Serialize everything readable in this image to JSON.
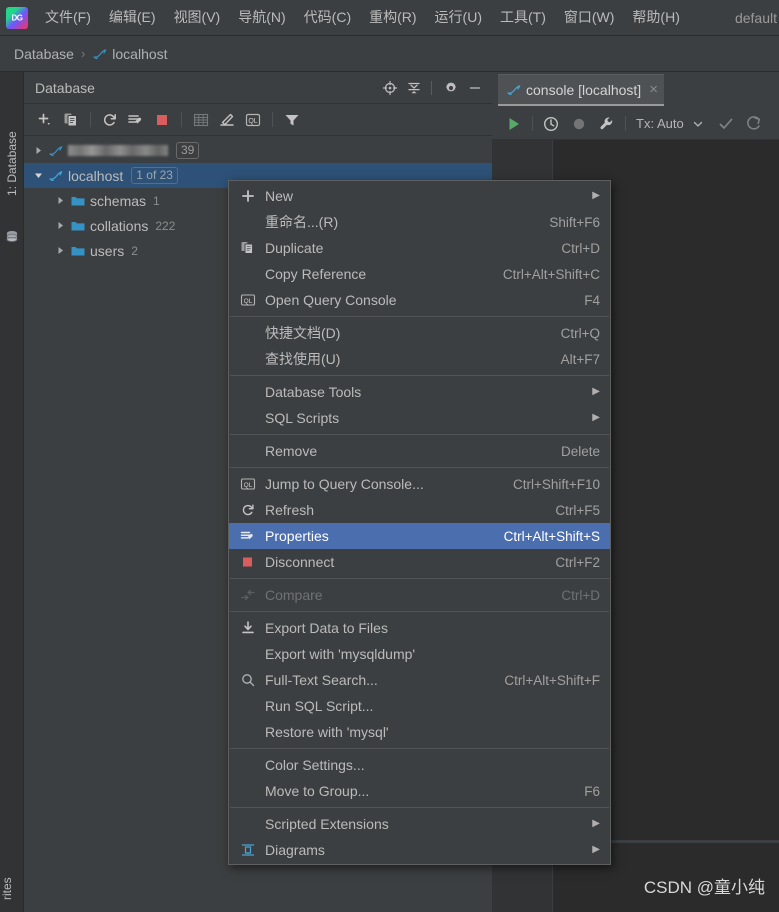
{
  "window": {
    "app_icon": "datagrip-logo-icon",
    "profile_label": "default"
  },
  "menubar": {
    "items": [
      {
        "label": "文件(F)",
        "mnemonic": "F"
      },
      {
        "label": "编辑(E)",
        "mnemonic": "E"
      },
      {
        "label": "视图(V)",
        "mnemonic": "V"
      },
      {
        "label": "导航(N)",
        "mnemonic": "N"
      },
      {
        "label": "代码(C)",
        "mnemonic": "C"
      },
      {
        "label": "重构(R)",
        "mnemonic": "R"
      },
      {
        "label": "运行(U)",
        "mnemonic": "U"
      },
      {
        "label": "工具(T)",
        "mnemonic": "T"
      },
      {
        "label": "窗口(W)",
        "mnemonic": "W"
      },
      {
        "label": "帮助(H)",
        "mnemonic": "H"
      }
    ]
  },
  "breadcrumb": {
    "root": "Database",
    "separator": "›",
    "leaf": "localhost"
  },
  "toolstrip": {
    "label_prefix": "1",
    "label": "1: Database",
    "db_icon": "database-stack-icon",
    "bottom_label": "rites"
  },
  "database_panel": {
    "title": "Database",
    "header_icons": [
      {
        "name": "locate-in-tree-icon"
      },
      {
        "name": "collapse-all-icon"
      },
      {
        "name": "settings-gear-icon"
      },
      {
        "name": "hide-panel-icon"
      }
    ],
    "toolbar_icons": [
      {
        "name": "add-datasource-icon"
      },
      {
        "name": "duplicate-icon"
      },
      {
        "name": "refresh-icon"
      },
      {
        "name": "properties-icon"
      },
      {
        "name": "stop-disconnect-icon"
      },
      {
        "name": "open-table-editor-icon"
      },
      {
        "name": "modify-object-icon"
      },
      {
        "name": "query-console-icon"
      },
      {
        "name": "filter-icon"
      }
    ],
    "tree": [
      {
        "name": "datasource-blurred",
        "label": "",
        "badge": "39",
        "badge_style": "plain",
        "icon": "mysql-dolphin-icon",
        "expanded": false,
        "selected": false,
        "blurred": true,
        "indent": 0
      },
      {
        "name": "datasource-localhost",
        "label": "localhost",
        "badge": "1 of 23",
        "badge_style": "accent",
        "icon": "mysql-dolphin-icon",
        "expanded": true,
        "selected": true,
        "blurred": false,
        "indent": 0
      },
      {
        "name": "node-schemas",
        "label": "schemas",
        "count": "1",
        "icon": "folder-icon",
        "expanded": false,
        "selected": false,
        "indent": 1
      },
      {
        "name": "node-collations",
        "label": "collations",
        "count": "222",
        "icon": "folder-icon",
        "expanded": false,
        "selected": false,
        "indent": 1
      },
      {
        "name": "node-users",
        "label": "users",
        "count": "2",
        "icon": "folder-icon",
        "expanded": false,
        "selected": false,
        "indent": 1
      }
    ]
  },
  "editor": {
    "tab": {
      "icon": "mysql-dolphin-icon",
      "title": "console [localhost]",
      "close": "×"
    },
    "toolbar": {
      "icons": [
        {
          "name": "execute-run-icon"
        },
        {
          "name": "history-clock-icon"
        },
        {
          "name": "record-dot-icon"
        },
        {
          "name": "wrench-settings-icon"
        }
      ],
      "tx_label": "Tx: Auto",
      "tx_chevron": "⌄",
      "commit_icon": "commit-check-icon",
      "rollback_icon": "rollback-icon"
    },
    "watermark": "CSDN @童小纯"
  },
  "context_menu": {
    "groups": [
      {
        "items": [
          {
            "name": "menu-item-new",
            "label": "New",
            "icon": "plus-icon",
            "submenu": true,
            "shortcut": "",
            "state": "normal"
          },
          {
            "name": "menu-item-rename",
            "label": "重命名...(R)",
            "mnemonic": "R",
            "icon": "",
            "submenu": false,
            "shortcut": "Shift+F6",
            "state": "normal"
          },
          {
            "name": "menu-item-duplicate",
            "label": "Duplicate",
            "icon": "duplicate-icon",
            "submenu": false,
            "shortcut": "Ctrl+D",
            "state": "normal"
          },
          {
            "name": "menu-item-copy-reference",
            "label": "Copy Reference",
            "icon": "",
            "submenu": false,
            "shortcut": "Ctrl+Alt+Shift+C",
            "state": "normal"
          },
          {
            "name": "menu-item-open-query-console",
            "label": "Open Query Console",
            "icon": "query-console-icon",
            "submenu": false,
            "shortcut": "F4",
            "state": "normal"
          }
        ]
      },
      {
        "items": [
          {
            "name": "menu-item-quick-documentation",
            "label": "快捷文档(D)",
            "mnemonic": "D",
            "icon": "",
            "submenu": false,
            "shortcut": "Ctrl+Q",
            "state": "normal"
          },
          {
            "name": "menu-item-find-usages",
            "label": "查找使用(U)",
            "mnemonic": "U",
            "icon": "",
            "submenu": false,
            "shortcut": "Alt+F7",
            "state": "normal"
          }
        ]
      },
      {
        "items": [
          {
            "name": "menu-item-database-tools",
            "label": "Database Tools",
            "icon": "",
            "submenu": true,
            "shortcut": "",
            "state": "normal"
          },
          {
            "name": "menu-item-sql-scripts",
            "label": "SQL Scripts",
            "icon": "",
            "submenu": true,
            "shortcut": "",
            "state": "normal"
          }
        ]
      },
      {
        "items": [
          {
            "name": "menu-item-remove",
            "label": "Remove",
            "icon": "",
            "submenu": false,
            "shortcut": "Delete",
            "state": "normal"
          }
        ]
      },
      {
        "items": [
          {
            "name": "menu-item-jump-to-query-console",
            "label": "Jump to Query Console...",
            "icon": "query-console-icon",
            "submenu": false,
            "shortcut": "Ctrl+Shift+F10",
            "state": "normal"
          },
          {
            "name": "menu-item-refresh",
            "label": "Refresh",
            "icon": "refresh-icon",
            "submenu": false,
            "shortcut": "Ctrl+F5",
            "state": "normal"
          },
          {
            "name": "menu-item-properties",
            "label": "Properties",
            "icon": "properties-icon",
            "submenu": false,
            "shortcut": "Ctrl+Alt+Shift+S",
            "state": "highlight"
          },
          {
            "name": "menu-item-disconnect",
            "label": "Disconnect",
            "icon": "stop-disconnect-icon",
            "submenu": false,
            "shortcut": "Ctrl+F2",
            "state": "normal"
          }
        ]
      },
      {
        "items": [
          {
            "name": "menu-item-compare",
            "label": "Compare",
            "icon": "compare-icon",
            "submenu": false,
            "shortcut": "Ctrl+D",
            "state": "disabled"
          }
        ]
      },
      {
        "items": [
          {
            "name": "menu-item-export-data-to-files",
            "label": "Export Data to Files",
            "mnemonic": "F",
            "icon": "export-download-icon",
            "submenu": false,
            "shortcut": "",
            "state": "normal"
          },
          {
            "name": "menu-item-export-with-mysqldump",
            "label": "Export with 'mysqldump'",
            "icon": "",
            "submenu": false,
            "shortcut": "",
            "state": "normal"
          },
          {
            "name": "menu-item-full-text-search",
            "label": "Full-Text Search...",
            "icon": "search-icon",
            "submenu": false,
            "shortcut": "Ctrl+Alt+Shift+F",
            "state": "normal"
          },
          {
            "name": "menu-item-run-sql-script",
            "label": "Run SQL Script...",
            "icon": "",
            "submenu": false,
            "shortcut": "",
            "state": "normal"
          },
          {
            "name": "menu-item-restore-with-mysql",
            "label": "Restore with 'mysql'",
            "icon": "",
            "submenu": false,
            "shortcut": "",
            "state": "normal"
          }
        ]
      },
      {
        "items": [
          {
            "name": "menu-item-color-settings",
            "label": "Color Settings...",
            "icon": "",
            "submenu": false,
            "shortcut": "",
            "state": "normal"
          },
          {
            "name": "menu-item-move-to-group",
            "label": "Move to Group...",
            "icon": "",
            "submenu": false,
            "shortcut": "F6",
            "state": "normal"
          }
        ]
      },
      {
        "items": [
          {
            "name": "menu-item-scripted-extensions",
            "label": "Scripted Extensions",
            "icon": "",
            "submenu": true,
            "shortcut": "",
            "state": "normal"
          },
          {
            "name": "menu-item-diagrams",
            "label": "Diagrams",
            "icon": "diagrams-icon",
            "submenu": true,
            "shortcut": "",
            "state": "normal"
          }
        ]
      }
    ]
  },
  "colors": {
    "background": "#3c3f41",
    "editor_background": "#2b2b2b",
    "panel_border": "#2b2b2b",
    "selection_tree": "#2d5177",
    "selection_menu": "#4b6eaf",
    "text_primary": "#bbbbbb",
    "text_secondary": "#a0a0a0",
    "text_disabled": "#6f7173",
    "accent_blue": "#3592c4",
    "stop_red": "#db5c5c",
    "run_green": "#59a869",
    "folder_blue": "#3592c4"
  }
}
